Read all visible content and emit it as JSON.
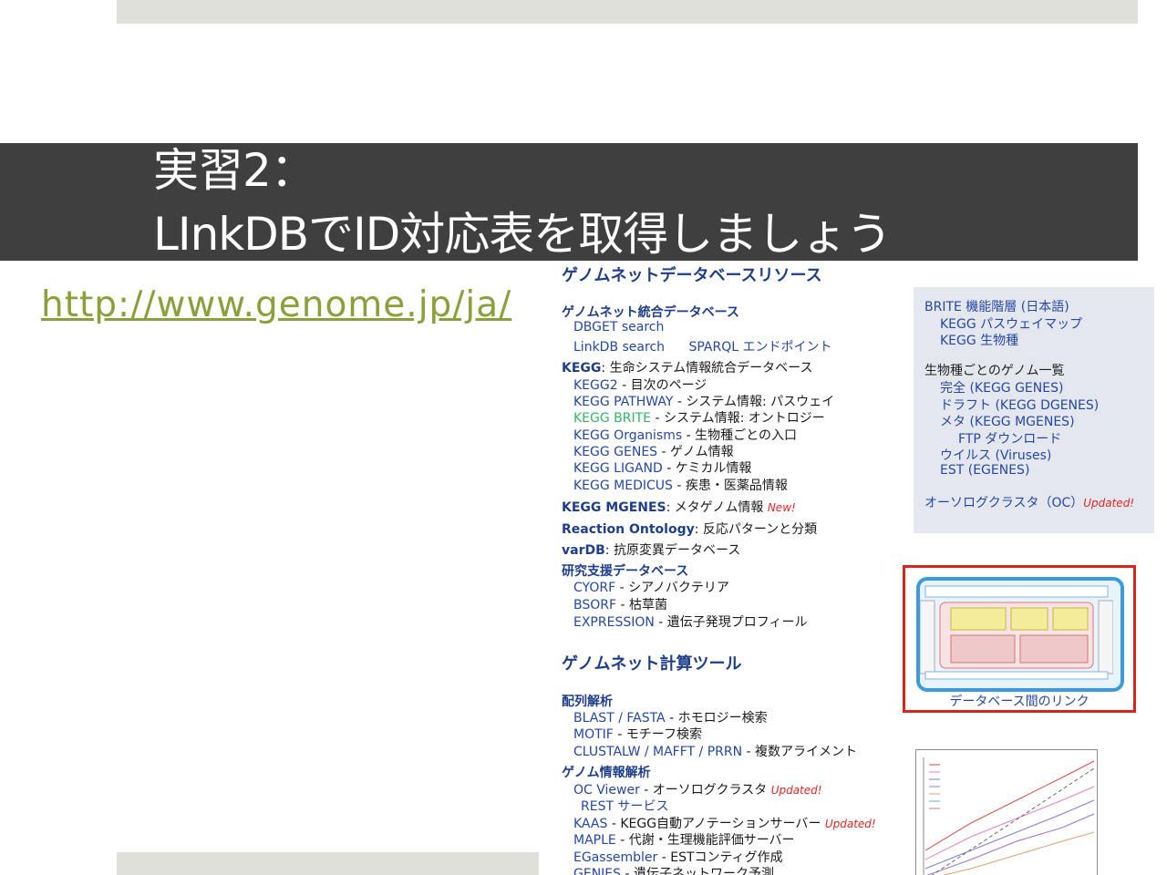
{
  "slide": {
    "title_line1": "実習2：",
    "title_line2": "LInkDBでID対応表を取得しましょう",
    "url": "http://www.genome.jp/ja/"
  },
  "genomenet": {
    "header": "ゲノムネットデータベースリソース",
    "integrated_db": {
      "heading": "ゲノムネット統合データベース",
      "dbget": "DBGET search",
      "linkdb": "LinkDB search",
      "sparql": "SPARQL エンドポイント"
    },
    "kegg": {
      "label": "KEGG",
      "desc": ": 生命システム情報統合データベース",
      "items": [
        {
          "link": "KEGG2",
          "desc": " - 目次のページ"
        },
        {
          "link": "KEGG PATHWAY",
          "desc": " - システム情報: パスウェイ"
        },
        {
          "link": "KEGG BRITE",
          "desc": " - システム情報: オントロジー"
        },
        {
          "link": "KEGG Organisms",
          "desc": " - 生物種ごとの入口"
        },
        {
          "link": "KEGG GENES",
          "desc": " - ゲノム情報"
        },
        {
          "link": "KEGG LIGAND",
          "desc": " - ケミカル情報"
        },
        {
          "link": "KEGG MEDICUS",
          "desc": " - 疾患・医薬品情報"
        }
      ]
    },
    "mgenes": {
      "label": "KEGG MGENES",
      "desc": ": メタゲノム情報 ",
      "tag": "New!"
    },
    "reaction": {
      "label": "Reaction Ontology",
      "desc": ": 反応パターンと分類"
    },
    "vardb": {
      "label": "varDB",
      "desc": ": 抗原変異データベース"
    },
    "research": {
      "heading": "研究支援データベース",
      "items": [
        {
          "link": "CYORF",
          "desc": " - シアノバクテリア"
        },
        {
          "link": "BSORF",
          "desc": " - 枯草菌"
        },
        {
          "link": "EXPRESSION",
          "desc": " - 遺伝子発現プロフィール"
        }
      ]
    },
    "tools_header": "ゲノムネット計算ツール",
    "seq": {
      "heading": "配列解析",
      "items": [
        {
          "link": "BLAST / FASTA",
          "desc": " - ホモロジー検索"
        },
        {
          "link": "MOTIF",
          "desc": " - モチーフ検索"
        },
        {
          "link": "CLUSTALW / MAFFT / PRRN",
          "desc": " - 複数アライメント"
        }
      ]
    },
    "genome_info": {
      "heading": "ゲノム情報解析",
      "oc": {
        "link": "OC Viewer",
        "desc": " - オーソログクラスタ ",
        "tag": "Updated!"
      },
      "rest": "REST サービス",
      "kaas": {
        "link": "KAAS",
        "desc": " - KEGG自動アノテーションサーバー ",
        "tag": "Updated!"
      },
      "maple": {
        "link": "MAPLE",
        "desc": " - 代謝・生理機能評価サーバー"
      },
      "egassembler": {
        "link": "EGassembler",
        "desc": " - ESTコンティグ作成"
      },
      "genies": {
        "link": "GENIES",
        "desc": " - 遺伝子ネットワーク予測"
      }
    },
    "side": {
      "brite": "BRITE 機能階層 (日本語)",
      "pathway_map": "KEGG パスウェイマップ",
      "organisms": "KEGG 生物種",
      "genome_list": "生物種ごとのゲノム一覧",
      "complete": "完全 (KEGG GENES)",
      "draft": "ドラフト (KEGG DGENES)",
      "meta": "メタ (KEGG MGENES)",
      "ftp": "FTP ダウンロード",
      "viruses": "ウイルス (Viruses)",
      "est": "EST (EGENES)",
      "ortholog": "オーソログクラスタ（OC）",
      "ortholog_tag": "Updated!"
    },
    "db_links_caption": "データベース間のリンク"
  },
  "colors": {
    "title_band": "#3f3f3f",
    "url_link": "#8aa03a",
    "genomenet_link": "#2546a6",
    "genomenet_heading": "#1e3e8c",
    "brite_link": "#2fb563",
    "tag_red": "#e32424",
    "figure_border": "#d9251c"
  }
}
